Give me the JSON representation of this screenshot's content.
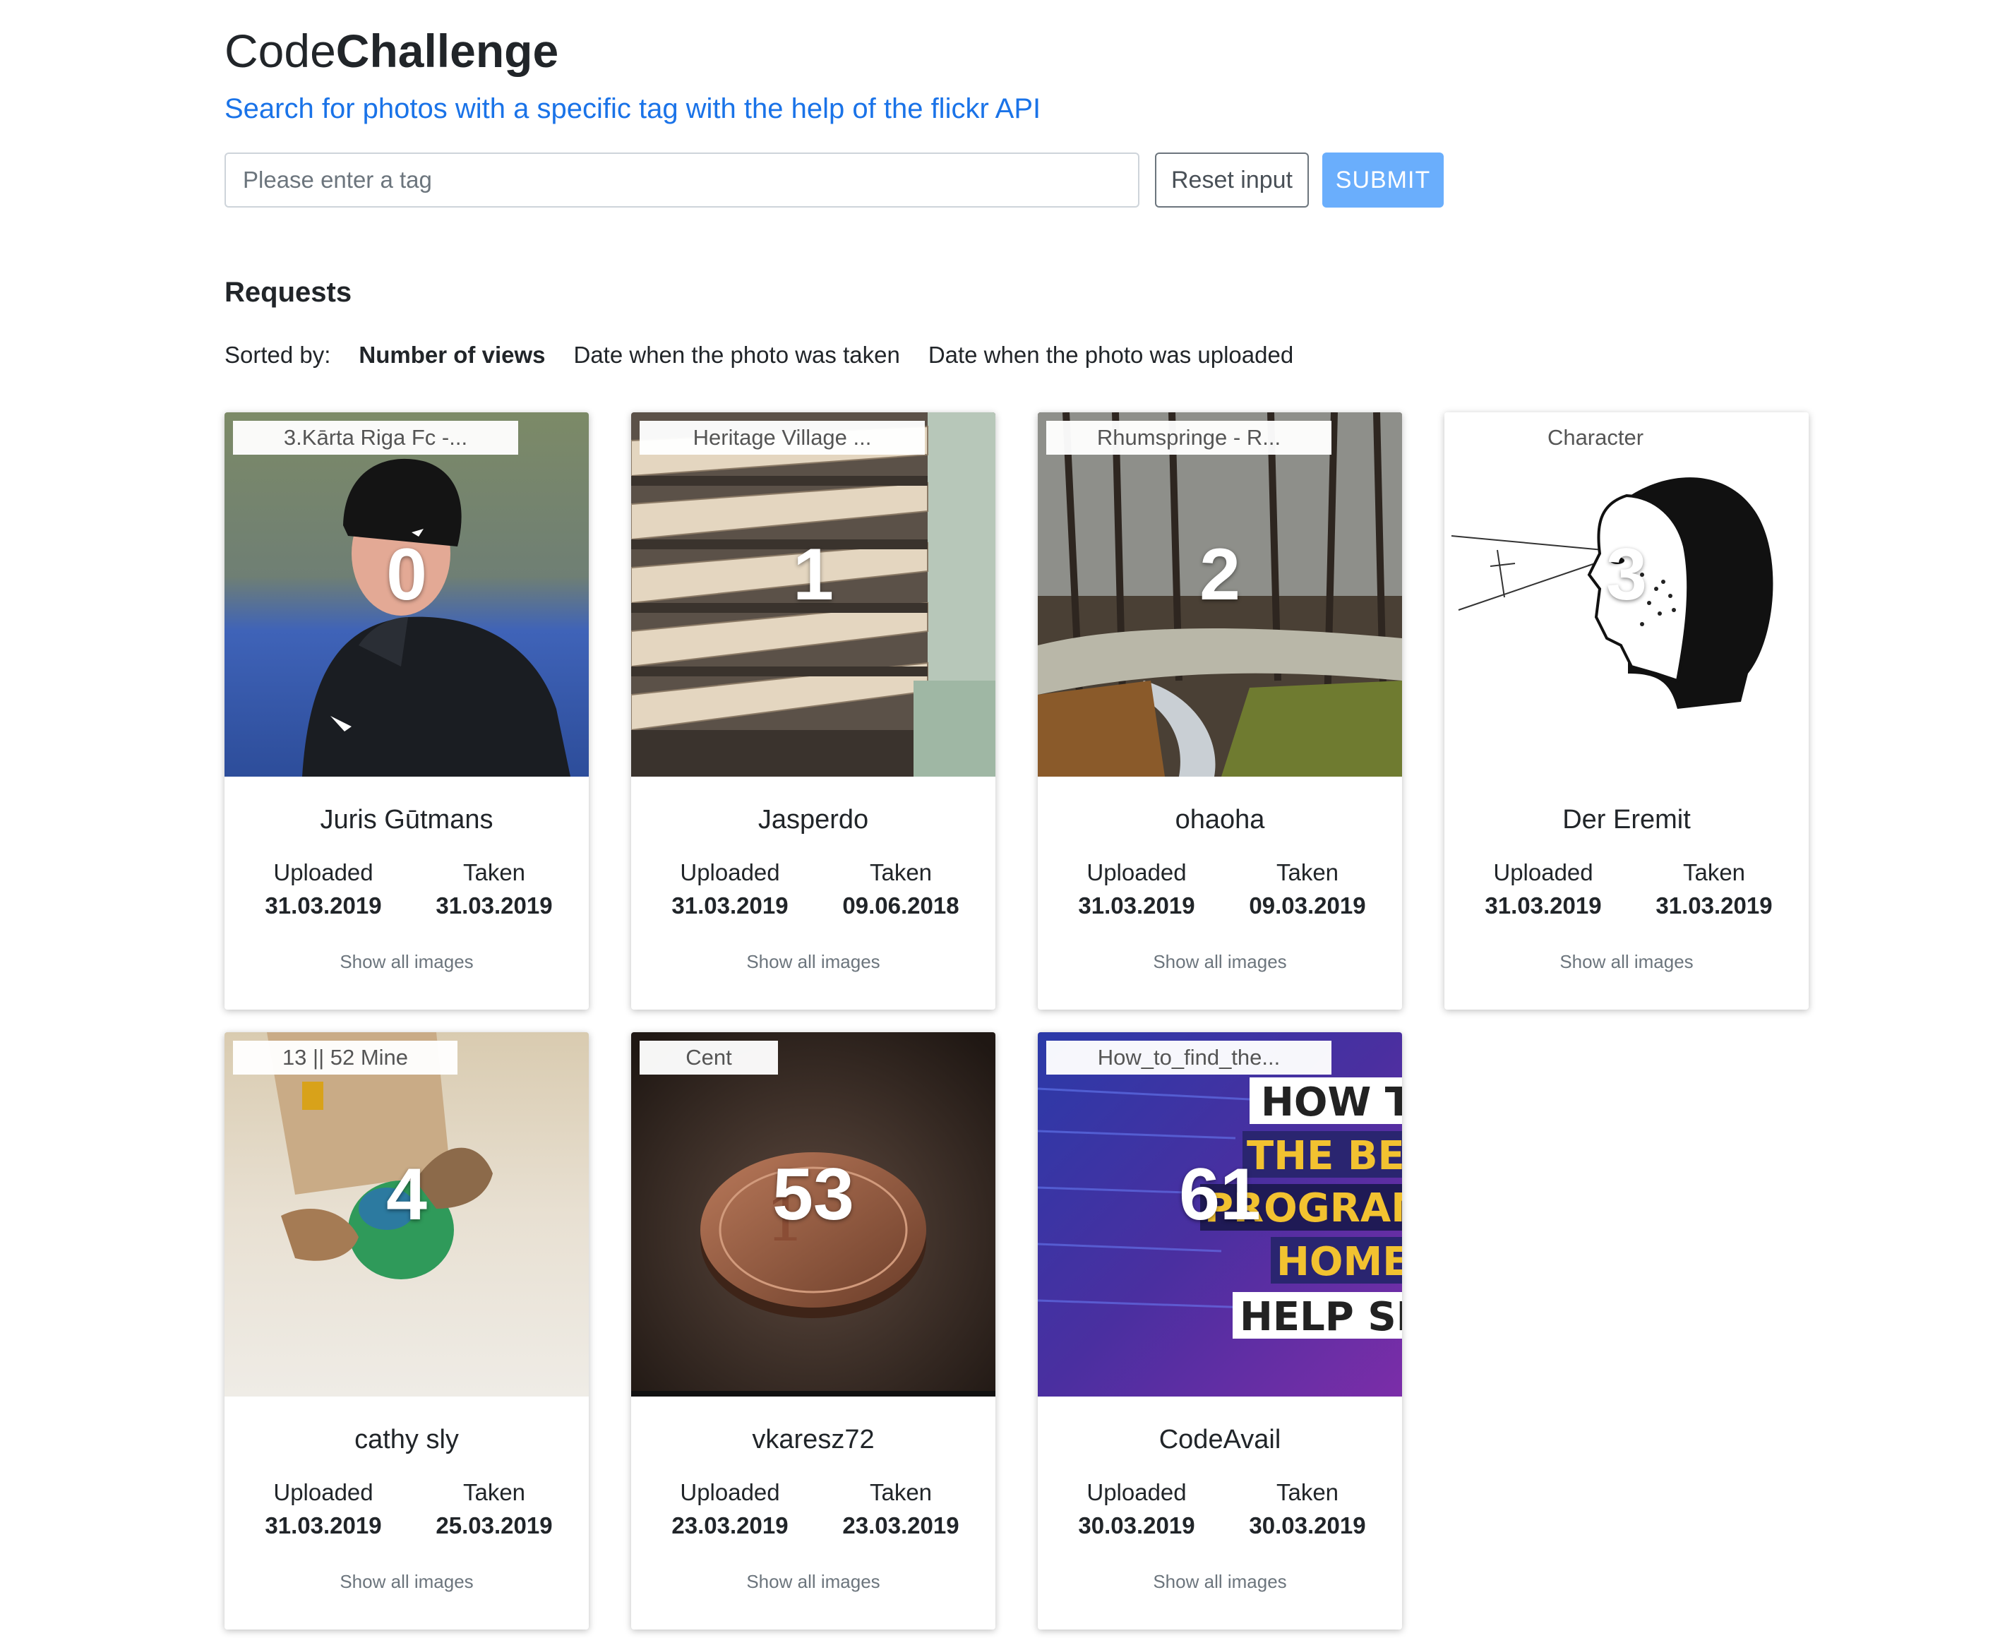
{
  "header": {
    "brand_light": "Code",
    "brand_bold": "Challenge",
    "subtitle": "Search for photos with a specific tag with the help of the flickr API"
  },
  "search": {
    "placeholder": "Please enter a tag",
    "value": "",
    "reset_label": "Reset input",
    "submit_label": "SUBMIT"
  },
  "requests": {
    "title": "Requests",
    "sort_label": "Sorted by:",
    "sort_options": [
      "Number of views",
      "Date when the photo was taken",
      "Date when the photo was uploaded"
    ],
    "active_sort": "Number of views"
  },
  "labels": {
    "uploaded": "Uploaded",
    "taken": "Taken",
    "show_all": "Show all images"
  },
  "photos": [
    {
      "title": "3.Kārta Riga Fc -...",
      "views": "0",
      "owner": "Juris Gūtmans",
      "uploaded": "31.03.2019",
      "taken": "31.03.2019",
      "image": "man-in-beanie"
    },
    {
      "title": "Heritage Village ...",
      "views": "1",
      "owner": "Jasperdo",
      "uploaded": "31.03.2019",
      "taken": "09.06.2018",
      "image": "mail-sorting-shelves"
    },
    {
      "title": "Rhumspringe - R...",
      "views": "2",
      "owner": "ohaoha",
      "uploaded": "31.03.2019",
      "taken": "09.03.2019",
      "image": "forest-river"
    },
    {
      "title": "Character",
      "views": "3",
      "owner": "Der Eremit",
      "uploaded": "31.03.2019",
      "taken": "31.03.2019",
      "image": "drawn-head-sketch"
    },
    {
      "title": "13 || 52 Mine",
      "views": "4",
      "owner": "cathy sly",
      "uploaded": "31.03.2019",
      "taken": "25.03.2019",
      "image": "dog-with-ball"
    },
    {
      "title": "Cent",
      "views": "53",
      "owner": "vkaresz72",
      "uploaded": "23.03.2019",
      "taken": "23.03.2019",
      "image": "one-cent-coin"
    },
    {
      "title": "How_to_find_the...",
      "views": "61",
      "owner": "CodeAvail",
      "uploaded": "30.03.2019",
      "taken": "30.03.2019",
      "image": "promo-text-banner"
    }
  ],
  "image_text": {
    "promo_lines": [
      "HOW TO",
      "THE BES",
      "PROGRAM",
      "HOMEW",
      "HELP SE"
    ],
    "coin_mark": "1"
  },
  "colors": {
    "accent_link": "#1a73e8",
    "submit_button": "#6aaefc",
    "text": "#212529",
    "muted": "#6c757d"
  }
}
